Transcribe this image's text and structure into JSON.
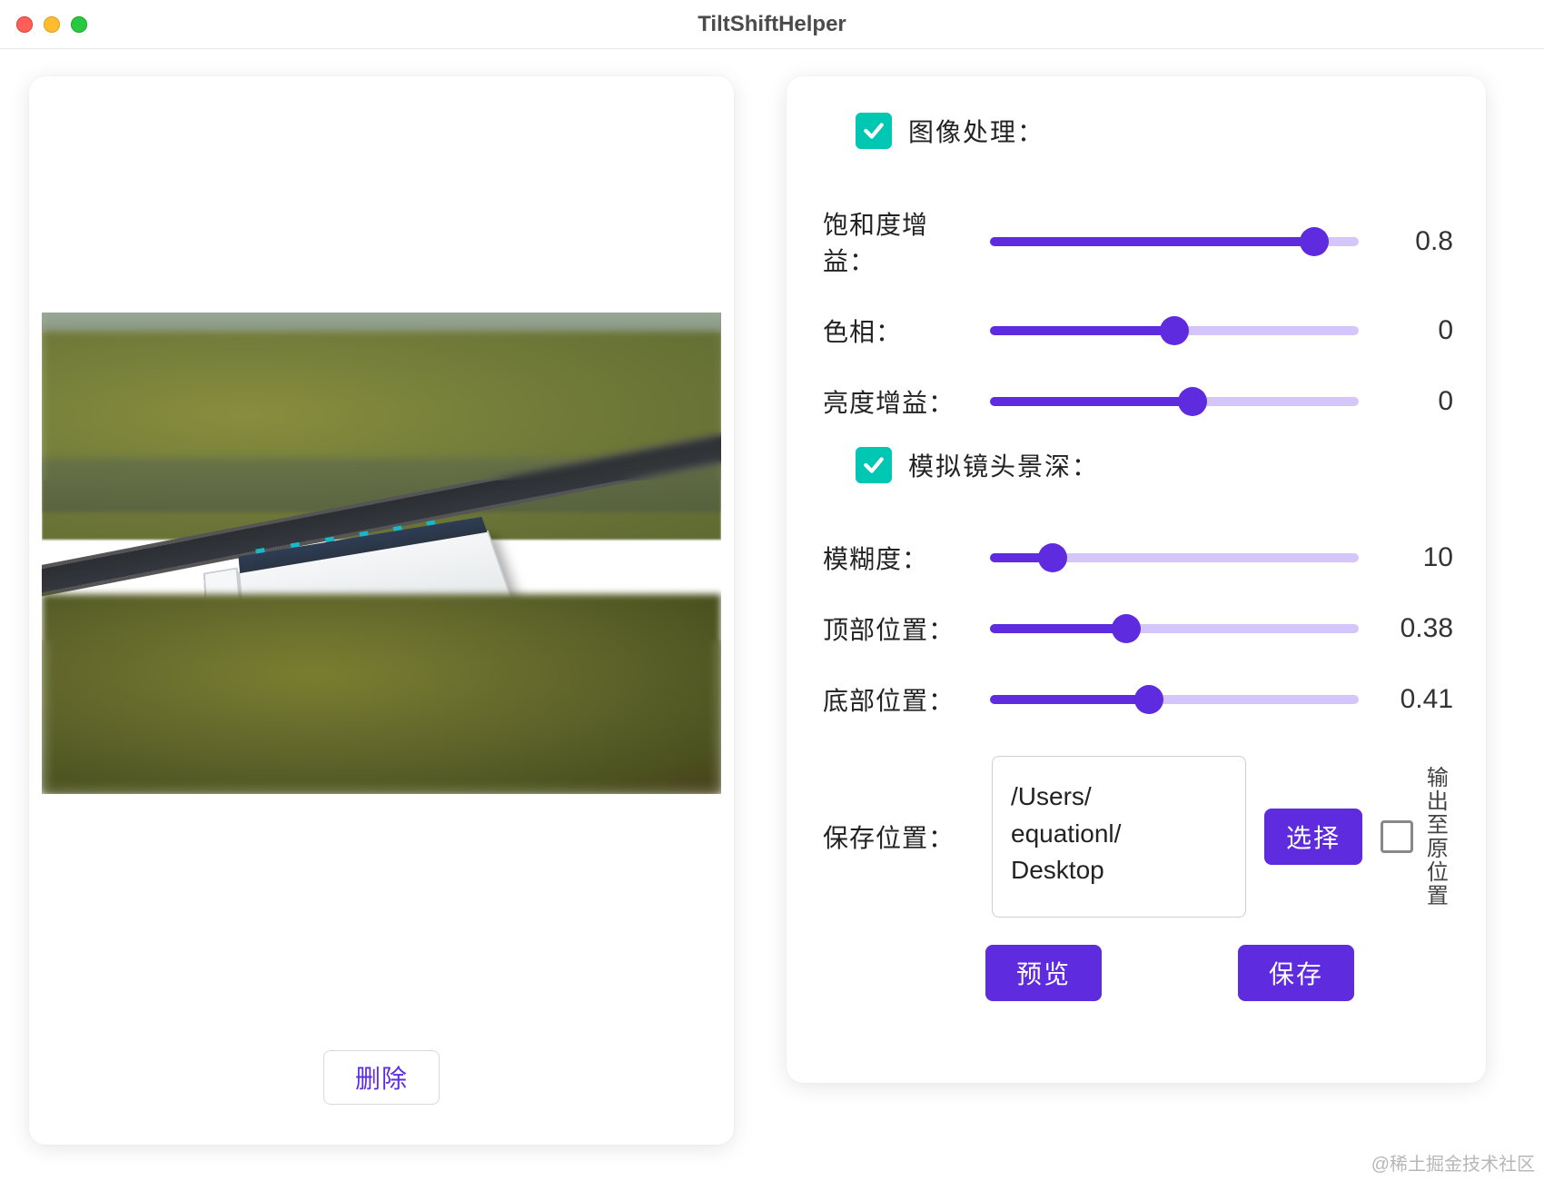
{
  "window": {
    "title": "TiltShiftHelper"
  },
  "left": {
    "delete_label": "删除"
  },
  "section1": {
    "checked": true,
    "label": "图像处理："
  },
  "sliders1": {
    "saturation": {
      "label": "饱和度增益：",
      "value": 0.8,
      "display": "0.8",
      "pct": 88
    },
    "hue": {
      "label": "色相：",
      "value": 0,
      "display": "0",
      "pct": 50
    },
    "brightness": {
      "label": "亮度增益：",
      "value": 0,
      "display": "0",
      "pct": 55
    }
  },
  "section2": {
    "checked": true,
    "label": "模拟镜头景深："
  },
  "sliders2": {
    "blur": {
      "label": "模糊度：",
      "value": 10,
      "display": "10",
      "pct": 17
    },
    "top": {
      "label": "顶部位置：",
      "value": 0.38,
      "display": "0.38",
      "pct": 37
    },
    "bottom": {
      "label": "底部位置：",
      "value": 0.41,
      "display": "0.41",
      "pct": 43
    }
  },
  "save": {
    "label": "保存位置：",
    "path": "/Users/\nequationl/\nDesktop",
    "choose_label": "选择",
    "output_original_label": "输出至原位置",
    "output_original_checked": false
  },
  "actions": {
    "preview": "预览",
    "save": "保存"
  },
  "watermark": "@稀土掘金技术社区",
  "colors": {
    "accent": "#5f2bdf",
    "teal": "#00c7b1"
  }
}
